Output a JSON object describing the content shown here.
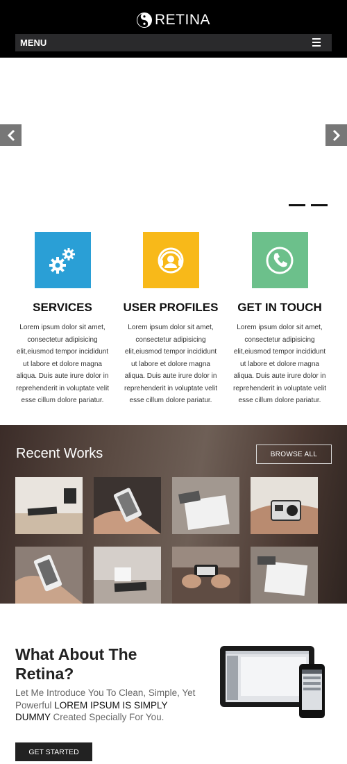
{
  "header": {
    "logo_text": "RETINA",
    "menu_label": "MENU"
  },
  "slider": {
    "prev_icon": "chevron-left-icon",
    "next_icon": "chevron-right-icon",
    "dots": 2
  },
  "features": [
    {
      "icon": "gears-icon",
      "color": "#2a9fd6",
      "title": "SERVICES",
      "lines": [
        "Lorem ipsum dolor sit amet,",
        "consectetur adipisicing",
        "elit,eiusmod tempor incididunt",
        "ut labore et dolore magna",
        "aliqua. Duis aute irure dolor in",
        "reprehenderit in voluptate velit",
        "esse cillum dolore pariatur."
      ]
    },
    {
      "icon": "user-support-icon",
      "color": "#f8b919",
      "title": "USER PROFILES",
      "lines": [
        "Lorem ipsum dolor sit amet,",
        "consectetur adipisicing",
        "elit,eiusmod tempor incididunt",
        "ut labore et dolore magna",
        "aliqua. Duis aute irure dolor in",
        "reprehenderit in voluptate velit",
        "esse cillum dolore pariatur."
      ]
    },
    {
      "icon": "phone-icon",
      "color": "#6cc08b",
      "title": "GET IN TOUCH",
      "lines": [
        "Lorem ipsum dolor sit amet,",
        "consectetur adipisicing",
        "elit,eiusmod tempor incididunt",
        "ut labore et dolore magna",
        "aliqua. Duis aute irure dolor in",
        "reprehenderit in voluptate velit",
        "esse cillum dolore pariatur."
      ]
    }
  ],
  "works": {
    "title": "Recent Works",
    "browse_label": "BROWSE ALL",
    "thumbs": [
      "notebook-desk",
      "phone-in-hand",
      "box-and-phone",
      "action-camera",
      "phone-in-hand",
      "cup-and-notebook",
      "phone-photo",
      "box-on-table"
    ]
  },
  "about": {
    "title_line1": "What About The",
    "title_line2": "Retina?",
    "text_a": "Let Me Introduce You To Clean, Simple, Yet Powerful ",
    "text_highlight": "LOREM IPSUM IS SIMPLY DUMMY",
    "text_b": " Created Specially For You.",
    "button_label": "GET STARTED"
  }
}
